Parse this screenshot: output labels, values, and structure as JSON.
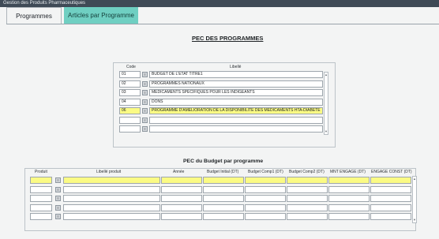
{
  "window": {
    "title": "Gestion des Produits Pharmaceutiques"
  },
  "tabs": [
    {
      "label": "Programmes"
    },
    {
      "label": "Articles par Programme"
    }
  ],
  "programmes": {
    "heading": "PEC DES PROGRAMMES",
    "col_code": "Code",
    "col_libelle": "Libellé",
    "rows": [
      {
        "code": "01",
        "libelle": "BUDGET DE L'ETAT TITRE1"
      },
      {
        "code": "02",
        "libelle": "PROGRAMMES NATIONAUX"
      },
      {
        "code": "03",
        "libelle": "MEDICAMENTS SPECIFIQUES POUR LES INDIGEANTS"
      },
      {
        "code": "04",
        "libelle": "DONS"
      },
      {
        "code": "06",
        "libelle": "PROGRAMME D'AMELIORATION DE LA DISPONIBILITE DES MEDICAMENTS HTA-DIABETE"
      },
      {
        "code": "",
        "libelle": ""
      },
      {
        "code": "",
        "libelle": ""
      }
    ]
  },
  "budget": {
    "heading": "PEC du Budget par programme",
    "columns": {
      "produit": "Produit",
      "libelle_produit": "Libellé produit",
      "annee": "Année",
      "budget_initial": "Budget Initial (DT)",
      "budget_comp1": "Budget Comp1 (DT)",
      "budget_comp2": "Budget Comp2 (DT)",
      "mnt_engage": "MNT ENGAGE (DT)",
      "engage_const": "ENGAGE CONST (DT)"
    }
  },
  "icons": {
    "lov": "list-of-values-icon",
    "scroll_up": "scroll-up-icon",
    "scroll_down": "scroll-down-icon"
  },
  "colors": {
    "accent_tab": "#6fcfc2",
    "highlight_row": "#fbfb84"
  }
}
